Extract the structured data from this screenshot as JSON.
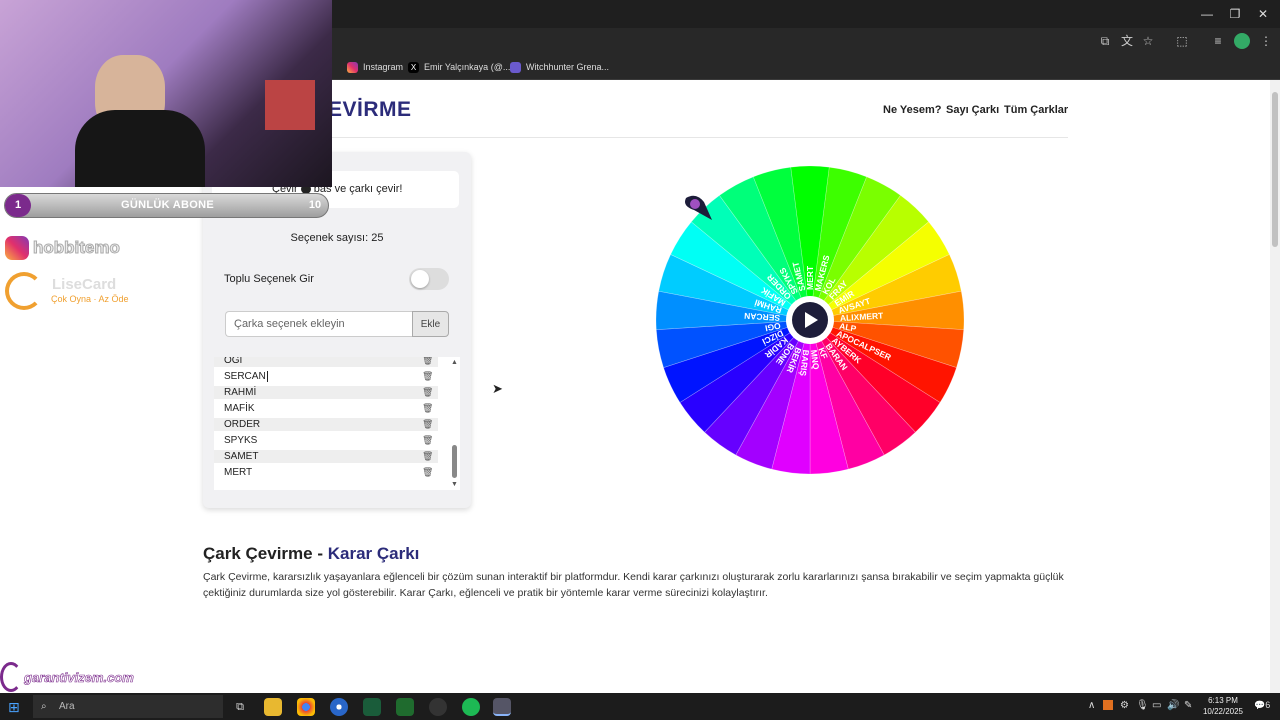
{
  "browser": {
    "bookmarks": [
      {
        "label": "Instagram",
        "color": "#e1306c"
      },
      {
        "label": "Emir Yalçınkaya (@...",
        "color": "#000000"
      },
      {
        "label": "Witchhunter Grena...",
        "color": "#6a5acd"
      }
    ]
  },
  "site": {
    "brand": "EVİRME",
    "nav": [
      "Ne Yesem?",
      "Sayı Çarkı",
      "Tüm Çarklar"
    ]
  },
  "panel": {
    "hint_prefix": "Çevir",
    "hint_suffix": "bas ve çarkı çevir!",
    "option_count": "Seçenek sayısı: 25",
    "bulk_label": "Toplu Seçenek Gir",
    "bulk_enabled": false,
    "input_placeholder": "Çarka seçenek ekleyin",
    "add_button": "Ekle",
    "options": [
      "OGI",
      "SERCAN",
      "RAHMİ",
      "MAFİK",
      "ORDER",
      "SPYKS",
      "SAMET",
      "MERT"
    ]
  },
  "wheel": {
    "labels": [
      "MERT",
      "MAKERS",
      "KOL",
      "FRAY",
      "EMİR",
      "AVSAYT",
      "ALIXMERT",
      "ALP",
      "APOCALPSER",
      "AYBERK",
      "BARAN",
      "KF",
      "MNQ",
      "BARIŞ",
      "BEKİR",
      "BONE",
      "KADİR",
      "DİZCİ",
      "OGI",
      "SERCAN",
      "RAHMİ",
      "MAFİK",
      "ORDER",
      "SPYKS",
      "SAMET"
    ]
  },
  "content": {
    "heading_main": "Çark Çevirme - ",
    "heading_accent": "Karar Çarkı",
    "paragraph": "Çark Çevirme, kararsızlık yaşayanlara eğlenceli bir çözüm sunan interaktif bir platformdur. Kendi karar çarkınızı oluşturarak zorlu kararlarınızı şansa bırakabilir ve seçim yapmakta güçlük çektiğiniz durumlarda size yol gösterebilir. Karar Çarkı, eğlenceli ve pratik bir yöntemle karar verme sürecinizi kolaylaştırır."
  },
  "overlay": {
    "sub_start": "1",
    "sub_label": "GÜNLÜK ABONE",
    "sub_goal": "10",
    "instagram": "hobbitemo",
    "lisecard_title": "LiseCard",
    "lisecard_tagline": "Çok Oyna · Az Öde",
    "sponsor": "garantivizem.com"
  },
  "taskbar": {
    "search_placeholder": "Ara",
    "time": "6:13 PM",
    "date": "10/22/2025",
    "notif_count": "6"
  }
}
